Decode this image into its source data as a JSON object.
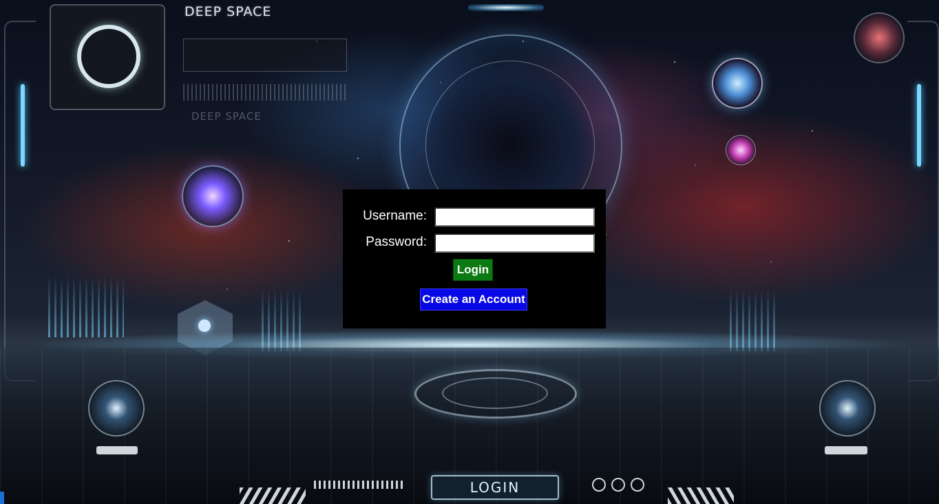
{
  "background": {
    "brand_title": "DEEP SPACE",
    "brand_echo": "DEEP SPACE",
    "floor_button_label": "LOGIN"
  },
  "login_form": {
    "username_label": "Username:",
    "username_value": "",
    "password_label": "Password:",
    "password_value": "",
    "login_button_label": "Login",
    "create_account_button_label": "Create an Account"
  },
  "colors": {
    "form_background": "#000000",
    "login_button": "#0c7a12",
    "create_account_button": "#0808e6",
    "label_text": "#ffffff"
  }
}
